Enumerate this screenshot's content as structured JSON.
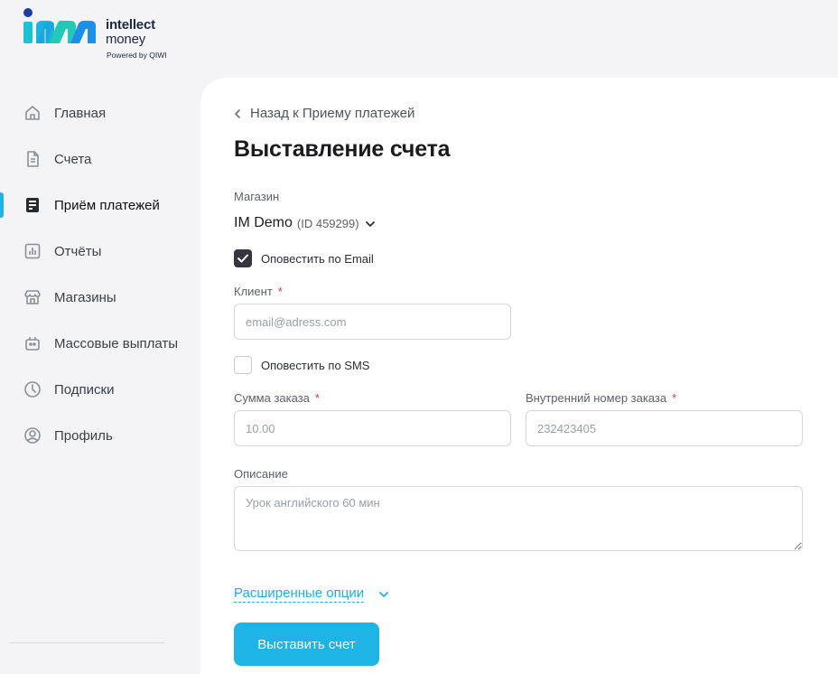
{
  "brand": {
    "name_line1": "intellect",
    "name_line2": "money",
    "powered": "Powered by QIWI"
  },
  "sidebar": {
    "items": [
      {
        "label": "Главная",
        "icon": "home-icon"
      },
      {
        "label": "Счета",
        "icon": "document-icon"
      },
      {
        "label": "Приём платежей",
        "icon": "terminal-icon",
        "active": true
      },
      {
        "label": "Отчёты",
        "icon": "chart-icon"
      },
      {
        "label": "Магазины",
        "icon": "store-icon"
      },
      {
        "label": "Массовые выплаты",
        "icon": "wallet-icon"
      },
      {
        "label": "Подписки",
        "icon": "clock-icon"
      },
      {
        "label": "Профиль",
        "icon": "user-icon"
      }
    ]
  },
  "main": {
    "back_label": "Назад к Приему платежей",
    "title": "Выставление счета",
    "shop": {
      "label": "Магазин",
      "name": "IM Demo",
      "id": "(ID 459299)"
    },
    "notify_email": {
      "label": "Оповестить по Email",
      "checked": true
    },
    "client": {
      "label": "Клиент",
      "required": "*",
      "placeholder": "email@adress.com",
      "value": ""
    },
    "notify_sms": {
      "label": "Оповестить по SMS",
      "checked": false
    },
    "amount": {
      "label": "Сумма заказа",
      "required": "*",
      "placeholder": "10.00",
      "value": ""
    },
    "order_number": {
      "label": "Внутренний номер заказа",
      "required": "*",
      "placeholder": "232423405",
      "value": ""
    },
    "description": {
      "label": "Описание",
      "placeholder": "Урок английского 60 мин",
      "value": ""
    },
    "advanced_label": "Расширенные опции",
    "submit_label": "Выставить счет"
  },
  "colors": {
    "accent": "#1eb4e6",
    "required": "#e2333b",
    "checkbox_checked": "#34383e",
    "background": "#f4f4f6"
  }
}
